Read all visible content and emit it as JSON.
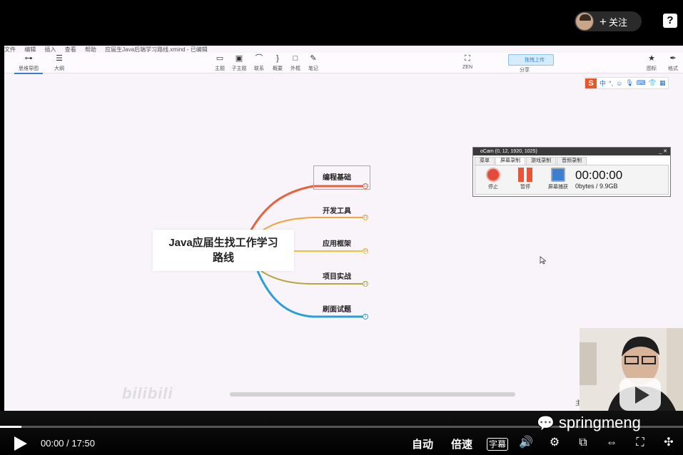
{
  "video": {
    "follow_label": "关注",
    "help_label": "?",
    "current_time": "00:00",
    "duration": "17:50",
    "time_sep": " / ",
    "progress": 0.0,
    "auto_label": "自动",
    "speed_label": "倍速",
    "subtitle_label": "字幕",
    "watermark": "springmeng",
    "bili_logo": "bilibili"
  },
  "app": {
    "menu": [
      "文件",
      "编辑",
      "插入",
      "查看",
      "帮助",
      "应届生Java后端学习路线.xmind - 已编辑"
    ],
    "toolbar": {
      "mindmap": "思维导图",
      "outline": "大纲",
      "topic": "主题",
      "subtopic": "子主题",
      "relation": "联系",
      "summary": "概要",
      "boundary": "外框",
      "note": "笔记",
      "zen": "ZEN",
      "upload": "拖拽上传",
      "share": "分享",
      "icon": "图标",
      "format": "格式"
    },
    "ime": {
      "s": "S",
      "mode": "中"
    },
    "main_mark": "主"
  },
  "mindmap": {
    "root_line1": "Java应届生找工作学习",
    "root_line2": "路线",
    "branches": [
      {
        "label": "编程基础",
        "count": "12",
        "color": "#e8603c"
      },
      {
        "label": "开发工具",
        "count": "11",
        "color": "#f2a33a"
      },
      {
        "label": "应用框架",
        "count": "10",
        "color": "#f1c232"
      },
      {
        "label": "项目实战",
        "count": "11",
        "color": "#b5a642"
      },
      {
        "label": "刷面试题",
        "count": "6",
        "color": "#2a9fd6"
      }
    ]
  },
  "ocam": {
    "title": "oCam (0, 12, 1920, 1025)",
    "tabs": [
      "菜单",
      "屏幕录制",
      "游戏录制",
      "音频录制"
    ],
    "active_tab": 1,
    "stop": "停止",
    "pause": "暂停",
    "capture": "屏幕捕获",
    "timer": "00:00:00",
    "size": "0bytes / 9.9GB"
  }
}
